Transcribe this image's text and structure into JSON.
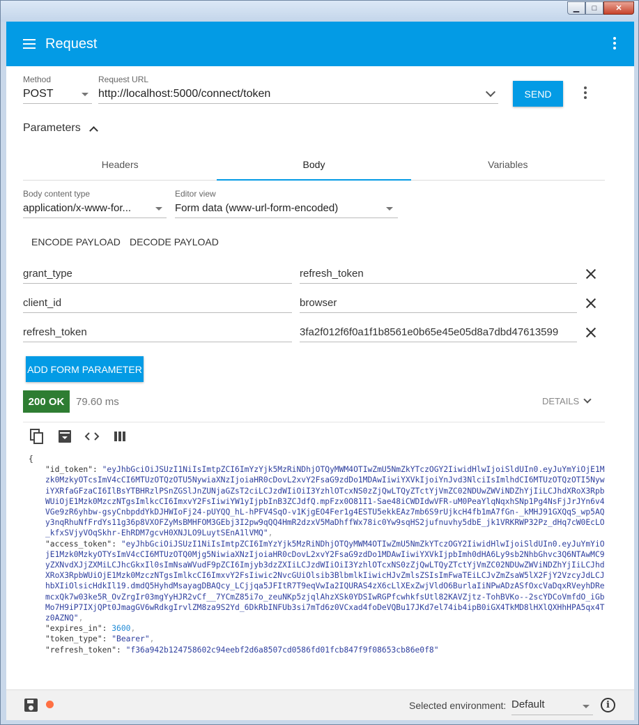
{
  "window": {
    "minimize": "▁",
    "maximize": "□",
    "close": "✕"
  },
  "appbar": {
    "title": "Request",
    "menu_icon": "hamburger-menu-icon",
    "more_icon": "more-vert-icon",
    "color": "#039be5"
  },
  "request": {
    "method_label": "Method",
    "method_value": "POST",
    "url_label": "Request URL",
    "url_value": "http://localhost:5000/connect/token",
    "send_label": "SEND"
  },
  "parameters": {
    "label": "Parameters",
    "tabs": [
      {
        "label": "Headers"
      },
      {
        "label": "Body"
      },
      {
        "label": "Variables"
      }
    ],
    "active_tab": "Body"
  },
  "body": {
    "content_type_label": "Body content type",
    "content_type_value": "application/x-www-for...",
    "editor_view_label": "Editor view",
    "editor_view_value": "Form data (www-url-form-encoded)",
    "encode_label": "ENCODE PAYLOAD",
    "decode_label": "DECODE PAYLOAD",
    "form_rows": [
      {
        "name": "grant_type",
        "value": "refresh_token"
      },
      {
        "name": "client_id",
        "value": "browser"
      },
      {
        "name": "refresh_token",
        "value": "3fa2f012f6f0a1f1b8561e0b65e45e05d8a7dbd47613599"
      }
    ],
    "add_param_label": "ADD FORM PARAMETER"
  },
  "response": {
    "status": "200 OK",
    "status_color": "#2e7d32",
    "time": "79.60 ms",
    "details_label": "DETAILS",
    "open_brace": "{",
    "json": {
      "id_token_key": "\"id_token\": ",
      "id_token_value": "\"eyJhbGciOiJSUzI1NiIsImtpZCI6ImYzYjk5MzRiNDhjOTQyMWM4OTIwZmU5NmZkYTczOGY2IiwidHlwIjoiSldUIn0.eyJuYmYiOjE1Mzk0MzkyOTcsImV4cCI6MTUzOTQzOTU5NywiaXNzIjoiaHR0cDovL2xvY2FsaG9zdDo1MDAwIiwiYXVkIjoiYnJvd3NlciIsImlhdCI6MTUzOTQzOTI5NywiYXRfaGFzaCI6IlBsYTBHRzlPSnZGSlJnZUNjaGZsT2ciLCJzdWIiOiI3YzhlOTcxNS0zZjQwLTQyZTctYjVmZC02NDUwZWViNDZhYjIiLCJhdXRoX3RpbWUiOjE1Mzk0MzczNTgsImlkcCI6ImxvY2FsIiwiYW1yIjpbInB3ZCJdfQ.mpFzx0O81I1-Sae48iCWDIdwVFR-uM0PeaYlqNqxhSNp1Pg4NsFjJrJYn6v4VGe9zR6yhbw-gsyCnbpddYkDJHWIoFj24-pUYQQ_hL-hPFV4SqO-v1KjgEO4Fer1g4ESTU5ekkEAz7mb6S9rUjkcH4fb1mA7fGn-_kMHJ91GXQqS_wp5AQy3nqRhuNfFrdYs11g36p8VXOFZyMsBMHFOM3GEbj3I2pw9qQQ4HmR2dzxV5MaDhffWx78ic0Yw9sqHS2jufnuvhy5dbE_jk1VRKRWP32Pz_dHq7cW0EcLO_kfxSVjyVOqSkhr-EhRDM7gcvH0XNJLO9LuytSEnA1lVMQ\"",
      "access_token_key": "\"access_token\": ",
      "access_token_value": "\"eyJhbGciOiJSUzI1NiIsImtpZCI6ImYzYjk5MzRiNDhjOTQyMWM4OTIwZmU5NmZkYTczOGY2IiwidHlwIjoiSldUIn0.eyJuYmYiOjE1Mzk0MzkyOTYsImV4cCI6MTUzOTQ0Mjg5NiwiaXNzIjoiaHR0cDovL2xvY2FsaG9zdDo1MDAwIiwiYXVkIjpbImh0dHA6Ly9sb2NhbGhvc3Q6NTAwMC9yZXNvdXJjZXMiLCJhcGkxIl0sImNsaWVudF9pZCI6Imjyb3dzZXIiLCJzdWIiOiI3YzhlOTcxNS0zZjQwLTQyZTctYjVmZC02NDUwZWViNDZhYjIiLCJhdXRoX3RpbWUiOjE1Mzk0MzczNTgsImlkcCI6ImxvY2FsIiwic2NvcGUiOlsib3BlbmlkIiwicHJvZmlsZSIsImFwaTEiLCJvZmZsaW5lX2FjY2VzcyJdLCJhbXIiOlsicHdkIl19.dmdQ5HyhdMsayagDBAQcy_LCjjqa5JFItR7T9eqVwIa2IQURAS4zX6cLlXExZwjVldO6BurlaIiNPwADzASfOxcVaDqxRVeyhDRemcxQk7w03ke5R_OvZrgIr03mgYyHJR2vCf__7YCmZ85i7o_zeuNKp5zjqlAhzXSk0YDSIwRGPfcwhkfsUtl82KAVZjtz-TohBVKo--2scYDCoVmfdO_iGbMo7H9iP7IXjQPt0JmagGV6wRdkgIrvlZM8za9S2Yd_6DkRbINFUb3si7mTd6z0VCxad4foDeVQBu17JKd7el74ib4ipB0iGX4TkMD8lHXlQXHhHPA5qx4Tz0AZNQ\"",
      "expires_in_key": "\"expires_in\": ",
      "expires_in_value": "3600",
      "token_type_key": "\"token_type\": ",
      "token_type_value": "\"Bearer\"",
      "refresh_token_key": "\"refresh_token\": ",
      "refresh_token_value": "\"f36a942b124758602c94eebf2d6a8507cd0586fd01fcb847f9f08653cb86e0f8\"",
      "comma": ","
    }
  },
  "footer": {
    "env_label": "Selected environment:",
    "env_value": "Default",
    "info": "i"
  }
}
